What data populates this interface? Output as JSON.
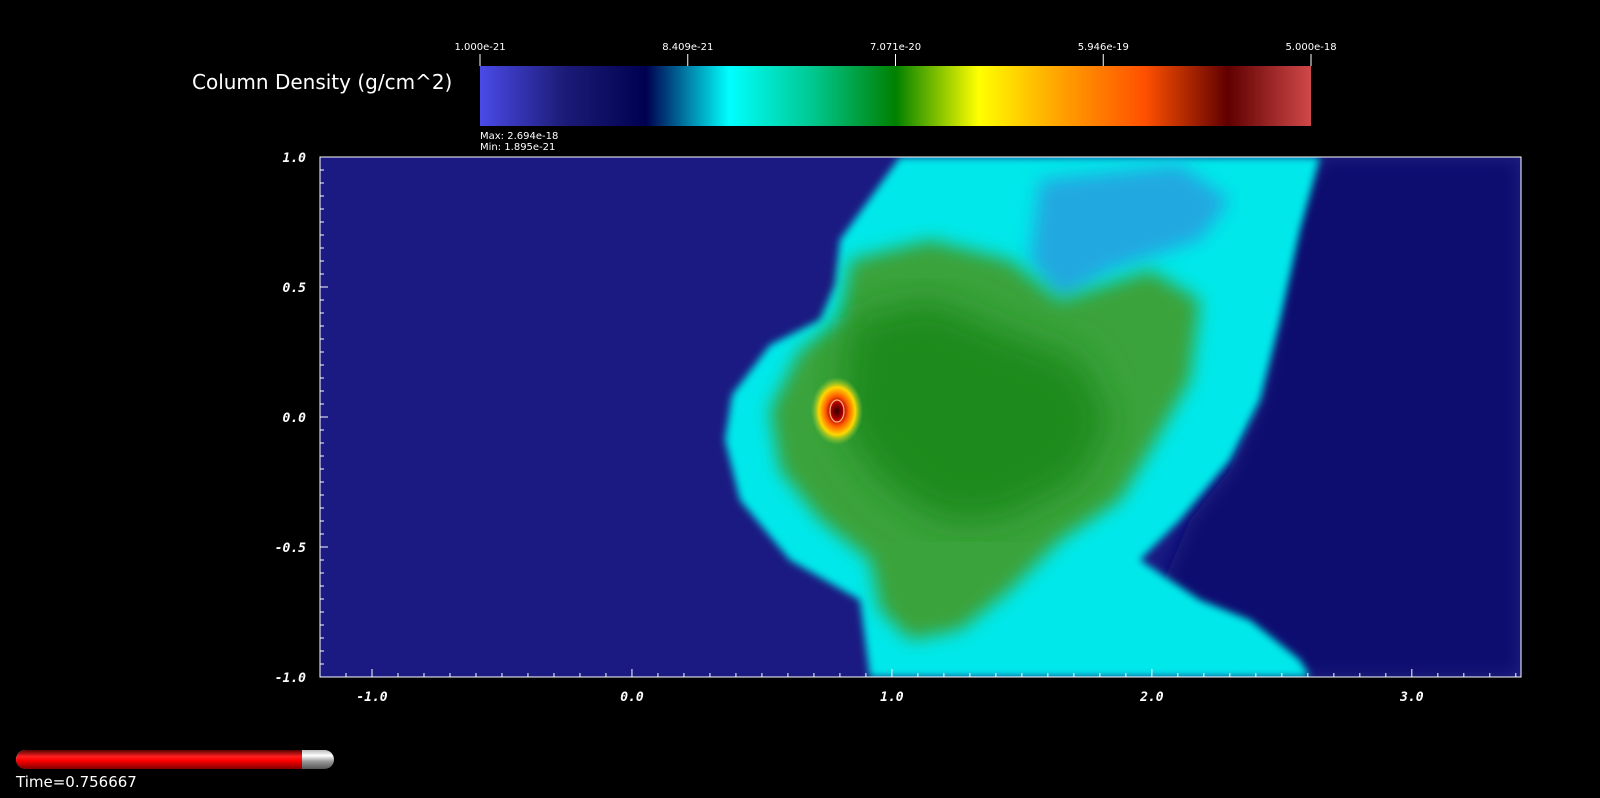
{
  "colorbar": {
    "title": "Column Density (g/cm^2)",
    "tick_labels": [
      "1.000e-21",
      "8.409e-21",
      "7.071e-20",
      "5.946e-19",
      "5.000e-18"
    ],
    "max_label": "Max:  2.694e-18",
    "min_label": "Min:  1.895e-21",
    "colors": [
      "#4a4ae8",
      "#1c1c78",
      "#000050",
      "#00ffff",
      "#00c890",
      "#008000",
      "#ffff00",
      "#ffa000",
      "#ff5000",
      "#600000",
      "#d04848"
    ]
  },
  "chart_data": {
    "type": "heatmap",
    "title": "Column Density (g/cm^2)",
    "xlabel": "",
    "ylabel": "",
    "xlim": [
      -1.2,
      3.42
    ],
    "ylim": [
      -1.0,
      1.0
    ],
    "x_ticks": [
      "-1.0",
      "0.0",
      "1.0",
      "2.0",
      "3.0"
    ],
    "y_ticks": [
      "1.0",
      "0.5",
      "0.0",
      "-0.5",
      "-1.0"
    ],
    "color_scale": "log",
    "color_range": [
      1e-21,
      5e-18
    ],
    "data_max": 2.694e-18,
    "data_min": 1.895e-21,
    "background_color": "#1a1a82",
    "peak_location": [
      0.8,
      0.02
    ]
  },
  "time": {
    "label": "Time=0.756667",
    "progress": 0.9
  }
}
